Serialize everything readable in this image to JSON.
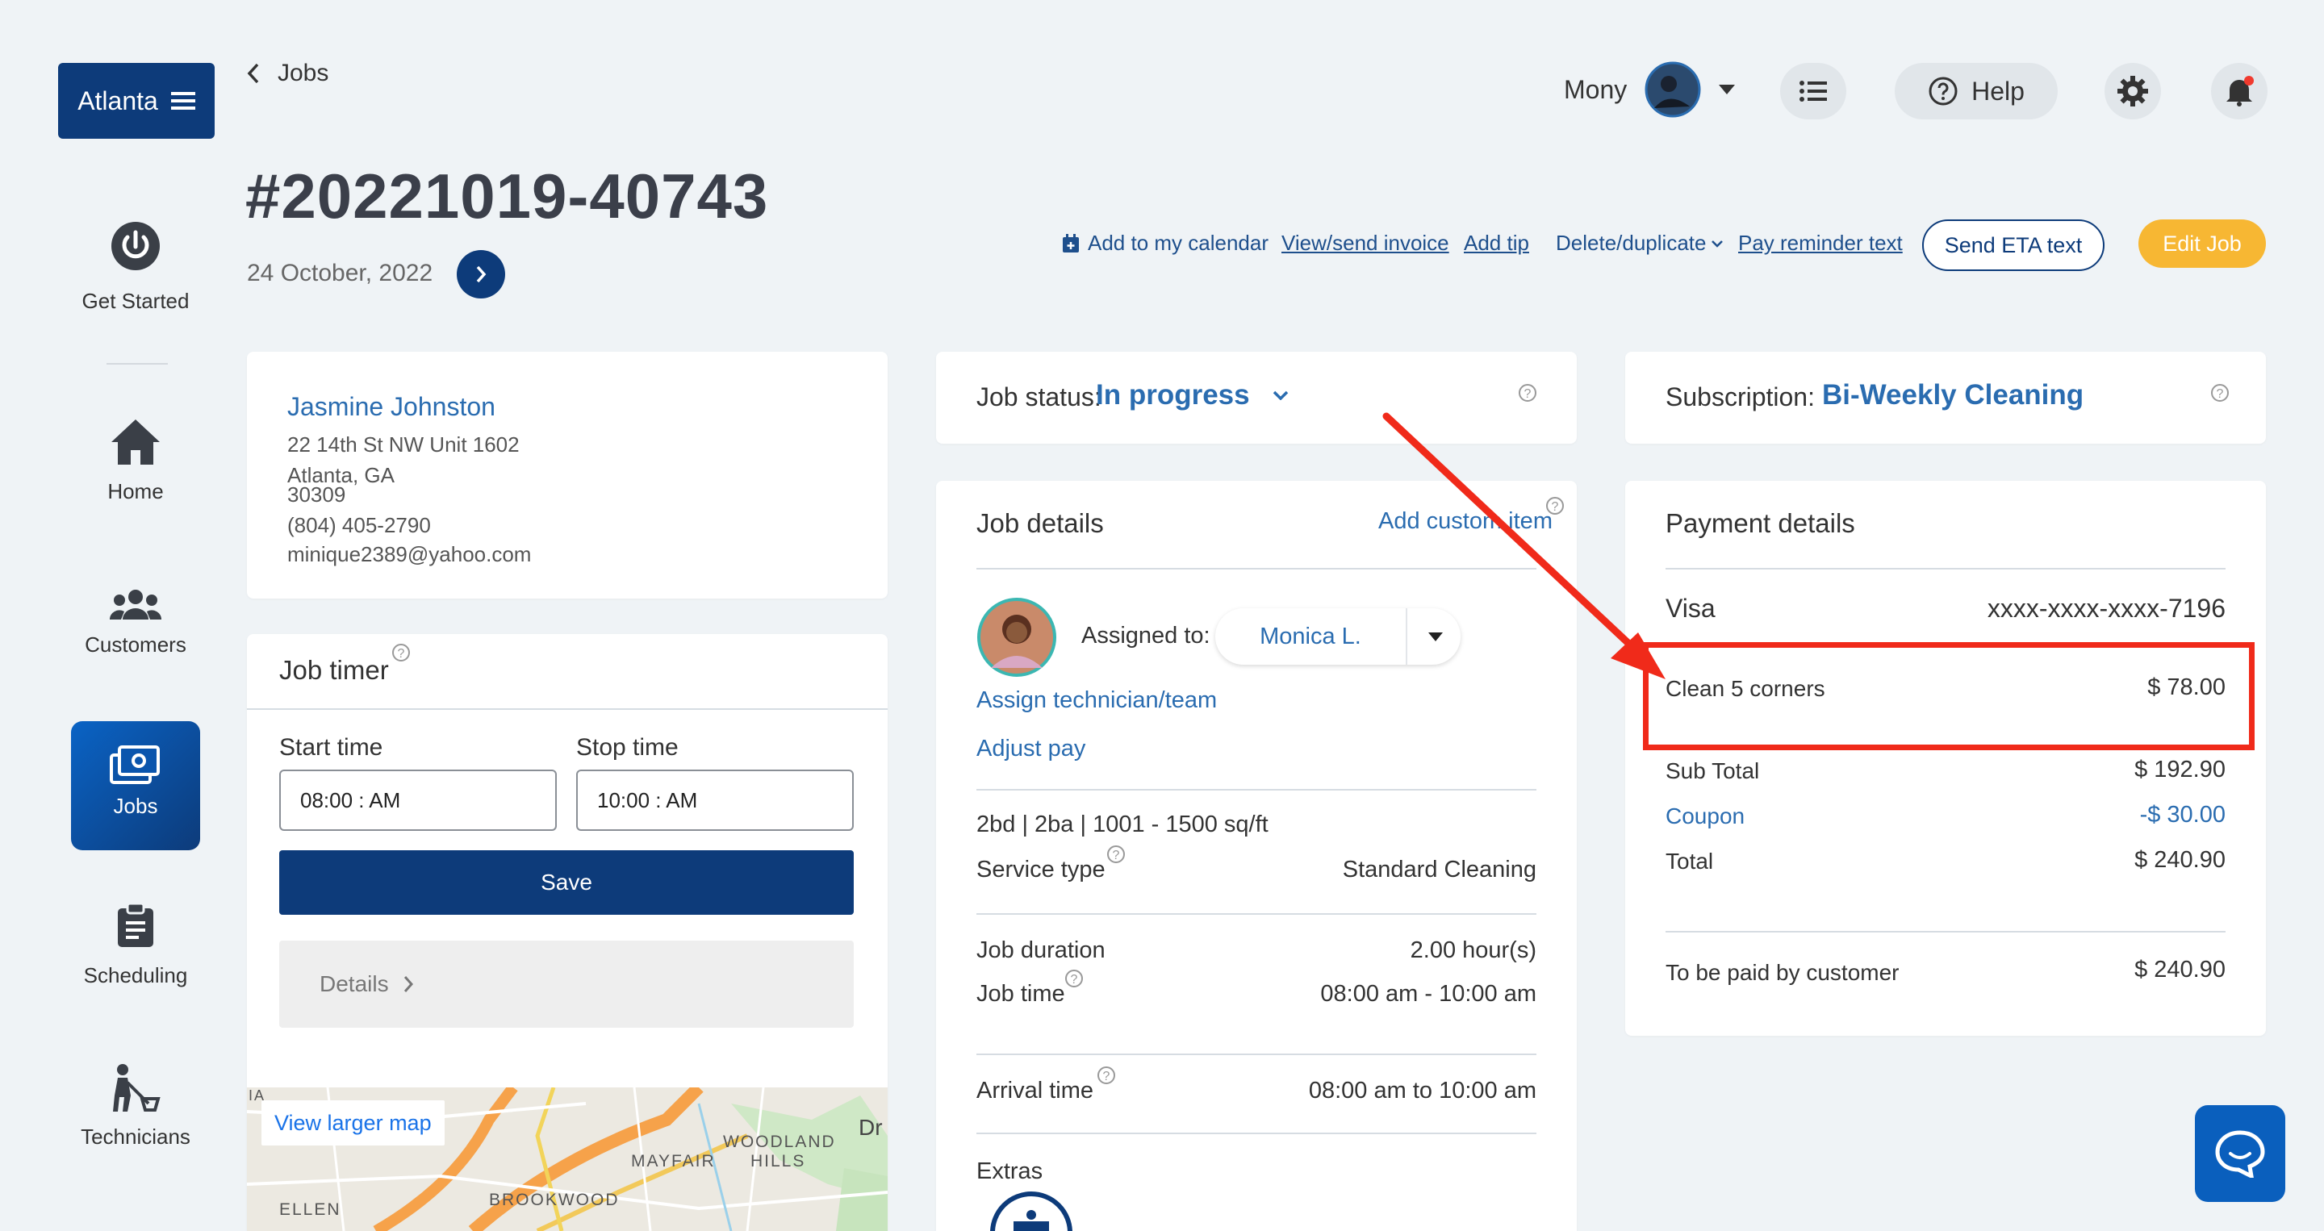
{
  "brand": {
    "city": "Atlanta"
  },
  "breadcrumb": {
    "back": "Jobs"
  },
  "sidebar": {
    "items": [
      {
        "label": "Get Started"
      },
      {
        "label": "Home"
      },
      {
        "label": "Customers"
      },
      {
        "label": "Jobs"
      },
      {
        "label": "Scheduling"
      },
      {
        "label": "Technicians"
      }
    ]
  },
  "header": {
    "user": "Mony",
    "help": "Help"
  },
  "job": {
    "number": "#20221019-40743",
    "date": "24 October, 2022"
  },
  "actions": {
    "calendar": "Add to my calendar",
    "invoice": "View/send invoice",
    "tip": "Add tip",
    "delete": "Delete/duplicate",
    "reminder": "Pay reminder text",
    "eta": "Send ETA text",
    "edit": "Edit Job"
  },
  "customer": {
    "name": "Jasmine Johnston",
    "address1": "22 14th St NW Unit 1602",
    "address2": "Atlanta, GA",
    "zip": "30309",
    "phone": "(804) 405-2790",
    "email": "minique2389@yahoo.com"
  },
  "timer": {
    "title": "Job timer",
    "start_label": "Start time",
    "stop_label": "Stop time",
    "start_value": "08:00 : AM",
    "stop_value": "10:00 : AM",
    "save": "Save",
    "details": "Details",
    "map_link": "View larger map",
    "map_labels": {
      "woodland": "WOODLAND",
      "hills": "HILLS",
      "mayfair": "MAYFAIR",
      "brookwood": "BROOKWOOD",
      "ellen": "ELLEN",
      "ia": "IA",
      "dr": "Dr"
    }
  },
  "status": {
    "label": "Job status:",
    "value": "In progress"
  },
  "details": {
    "title": "Job details",
    "add_custom": "Add custom item",
    "assigned_label": "Assigned to:",
    "assignee": "Monica L.",
    "assign_link": "Assign technician/team",
    "adjust_pay": "Adjust pay",
    "summary": "2bd | 2ba | 1001 - 1500 sq/ft",
    "service_type_label": "Service type",
    "service_type_value": "Standard Cleaning",
    "duration_label": "Job duration",
    "duration_value": "2.00 hour(s)",
    "time_label": "Job time",
    "time_value": "08:00 am - 10:00 am",
    "arrival_label": "Arrival time",
    "arrival_value": "08:00 am to 10:00 am",
    "extras_label": "Extras"
  },
  "subscription": {
    "label": "Subscription:",
    "value": "Bi-Weekly Cleaning"
  },
  "payment": {
    "title": "Payment details",
    "card_type": "Visa",
    "card_number": "xxxx-xxxx-xxxx-7196",
    "line_item": "Clean 5 corners",
    "line_amount": "$ 78.00",
    "subtotal_label": "Sub Total",
    "subtotal_value": "$ 192.90",
    "coupon_label": "Coupon",
    "coupon_value": "-$ 30.00",
    "total_label": "Total",
    "total_value": "$ 240.90",
    "to_pay_label": "To be paid by customer",
    "to_pay_value": "$ 240.90"
  },
  "colors": {
    "navy": "#0d3b7a",
    "accent_blue": "#2a6cb0",
    "edit_button": "#f7b733",
    "annotation_red": "#f02a1a"
  }
}
